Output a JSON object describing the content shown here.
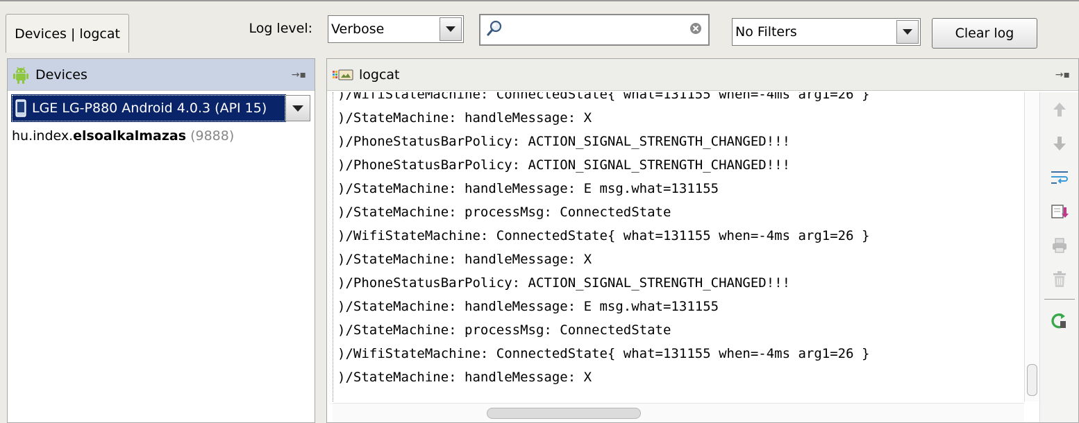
{
  "toolbar": {
    "tab_label": "Devices | logcat",
    "log_level_label": "Log level:",
    "log_level_value": "Verbose",
    "search_value": "",
    "filter_value": "No Filters",
    "clear_log_label": "Clear log"
  },
  "devices": {
    "header": "Devices",
    "selected_device": "LGE LG-P880 Android 4.0.3 (API 15)",
    "process": {
      "package_prefix": "hu.index.",
      "package_bold": "elsoalkalmazas",
      "pid": "(9888)"
    }
  },
  "logcat": {
    "header": "logcat",
    "lines": [
      ")/WifiStateMachine: ConnectedState{ what=131155 when=-4ms arg1=26 }",
      ")/StateMachine: handleMessage: X",
      ")/PhoneStatusBarPolicy: ACTION_SIGNAL_STRENGTH_CHANGED!!!",
      ")/PhoneStatusBarPolicy: ACTION_SIGNAL_STRENGTH_CHANGED!!!",
      ")/StateMachine: handleMessage: E msg.what=131155",
      ")/StateMachine: processMsg: ConnectedState",
      ")/WifiStateMachine: ConnectedState{ what=131155 when=-4ms arg1=26 }",
      ")/StateMachine: handleMessage: X",
      ")/PhoneStatusBarPolicy: ACTION_SIGNAL_STRENGTH_CHANGED!!!",
      ")/StateMachine: handleMessage: E msg.what=131155",
      ")/StateMachine: processMsg: ConnectedState",
      ")/WifiStateMachine: ConnectedState{ what=131155 when=-4ms arg1=26 }",
      ")/StateMachine: handleMessage: X"
    ]
  },
  "icons": {
    "android": "android-icon",
    "logcat": "logcat-icon",
    "search": "search-icon",
    "clear": "clear-search-icon",
    "phone": "phone-icon"
  },
  "colors": {
    "selection": "#0a246a",
    "android_green": "#8dc63f",
    "devices_header": "#c9d3e4"
  }
}
